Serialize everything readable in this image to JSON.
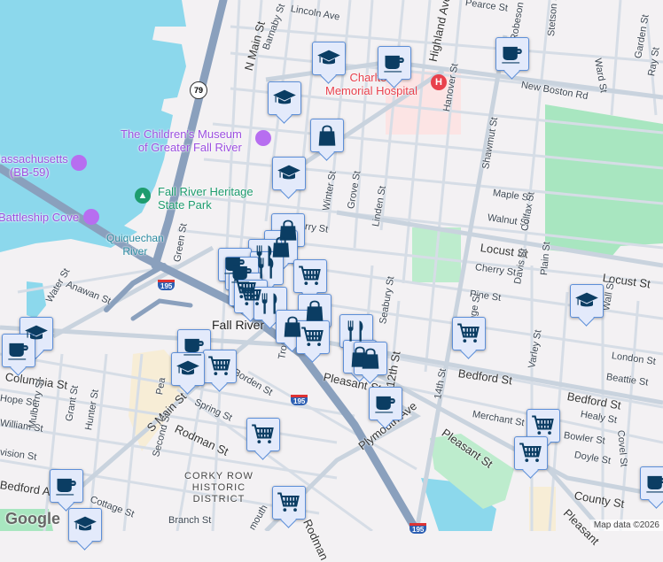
{
  "map": {
    "city_label": "Fall River",
    "district_label": [
      "CORKY ROW",
      "HISTORIC",
      "DISTRICT"
    ],
    "pois": {
      "hospital": [
        "Charlton",
        "Memorial Hospital"
      ],
      "museum": [
        "The Children's Museum",
        "of Greater Fall River"
      ],
      "ship": [
        "Massachusetts",
        "(BB-59)"
      ],
      "cove": "Battleship Cove",
      "park": [
        "Fall River Heritage",
        "State Park"
      ],
      "river": [
        "Quiquechan",
        "River"
      ]
    },
    "streets": {
      "lincoln": "Lincoln Ave",
      "barnaby": "Barnaby St",
      "nmain": "N Main St",
      "pearce": "Pearce St",
      "highland": "Highland Ave",
      "robeson": "Robeson St",
      "stetson": "Stetson St",
      "ward": "Ward St",
      "garden": "Garden St",
      "ray": "Ray St",
      "newboston": "New Boston Rd",
      "hanover": "Hanover St",
      "shawmut": "Shawmut St",
      "maple": "Maple St",
      "walnut": "Walnut St",
      "colfax": "Colfax St",
      "locust": "Locust St",
      "locust2": "Locust St",
      "winter": "Winter St",
      "grove": "Grove St",
      "linden": "Linden St",
      "cherry": "Cherry St",
      "cherry2": "rry St",
      "pine": "Pine St",
      "davis": "Davis St",
      "plain": "Plain St",
      "wall": "Wall St",
      "london": "London St",
      "beattie": "Beattie St",
      "bedford": "Bedford St",
      "bedford2": "Bedford St",
      "seabury": "Seabury St",
      "twelfth": "12th St",
      "fourteenth": "14th St",
      "orange": "Orange St",
      "varley": "Varley St",
      "merchant": "Merchant St",
      "healy": "Healy St",
      "bowler": "Bowler St",
      "doyle": "Doyle St",
      "covel": "Covel St",
      "pleasant": "Pleasant St",
      "pleasant2": "Pleasant St",
      "pleasant3": "Pleasant",
      "plymouth": "Plymouth Ave",
      "county": "County St",
      "green": "Green St",
      "water": "Water St",
      "anawan": "Anawan St",
      "columbia": "Columbia St",
      "hope": "Hope St",
      "william": "William St",
      "division": "vision St",
      "mulberry": "Mulberry St",
      "grant": "Grant St",
      "hunter": "Hunter St",
      "smain": "S Main St",
      "rodman": "Rodman St",
      "rodman2": "Rodman",
      "spring": "Spring St",
      "borden": "Borden St",
      "second": "Second St",
      "bedfordave": "Bedford Ave",
      "cottage": "Cottage St",
      "branch": "Branch St",
      "plymouth2": "mouth",
      "troy": "Tro",
      "pear": "Pea"
    },
    "shields": {
      "r79": "79",
      "i195a": "195",
      "i195b": "195",
      "i195c": "195"
    },
    "attribution": "Map data ©2026",
    "logo": "Google",
    "colors": {
      "water": "#8cd8ec",
      "park": "#a8e6c0",
      "highway": "#8aa0bd",
      "marker_icon": "#0b3d63",
      "poi_purple": "#9c4fe0",
      "hospital": "#e8404c"
    }
  }
}
